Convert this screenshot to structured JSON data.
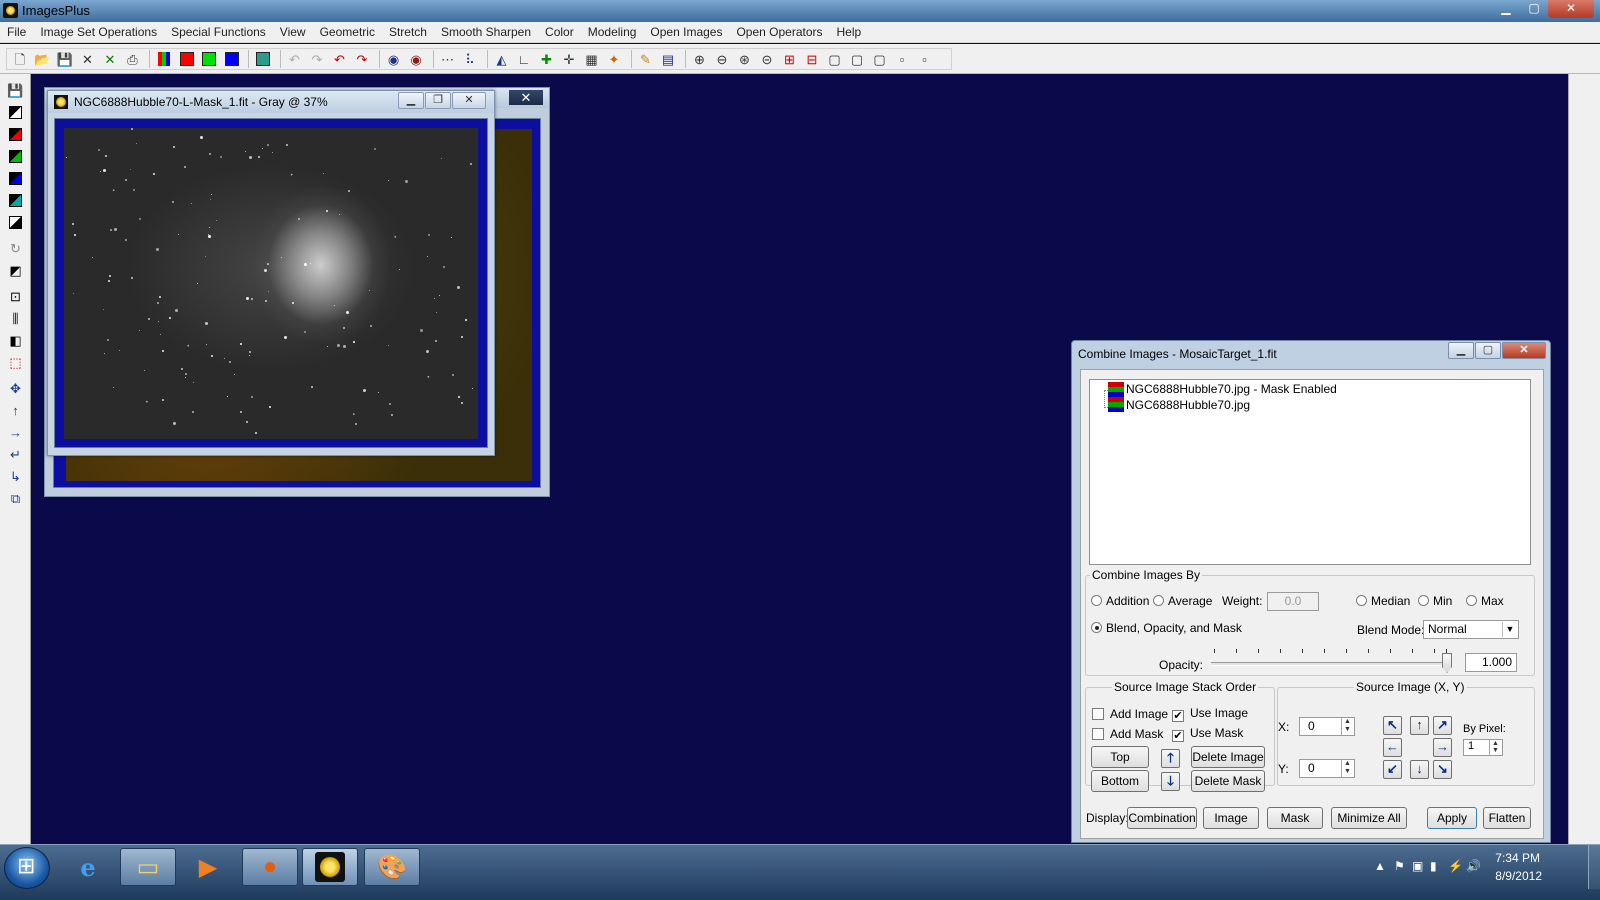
{
  "app": {
    "title": "ImagesPlus"
  },
  "menu": {
    "items": [
      "File",
      "Image Set Operations",
      "Special Functions",
      "View",
      "Geometric",
      "Stretch",
      "Smooth Sharpen",
      "Color",
      "Modeling",
      "Open Images",
      "Open Operators",
      "Help"
    ]
  },
  "toolbar": {
    "icons": [
      "new-icon",
      "open-icon",
      "save-icon",
      "close-image-icon",
      "close-all-icon",
      "print-icon",
      "rgb-channels-icon",
      "red-channel-icon",
      "green-channel-icon",
      "blue-channel-icon",
      "luminance-icon",
      "undo-disabled-icon",
      "redo-disabled-icon",
      "undo-icon",
      "redo-icon",
      "star-icon",
      "circle-icon",
      "dots-icon",
      "plot-icon",
      "histogram-icon",
      "curve-icon",
      "crosshair-plus-icon",
      "crosshair-icon",
      "calculator-icon",
      "palette-icon",
      "pencil-icon",
      "grid-icon",
      "zoom-in-icon",
      "zoom-out-icon",
      "zoom-fit-icon",
      "zoom-actual-icon",
      "zoom-plus-box-icon",
      "zoom-minus-box-icon",
      "view-box-1-icon",
      "view-box-2-icon",
      "view-box-3-icon",
      "view-box-4-icon",
      "view-box-5-icon"
    ],
    "colors": {
      "red": "#ff0000",
      "green": "#00e000",
      "blue": "#0000ff"
    }
  },
  "mdi": {
    "mask_window_title": "NGC6888Hubble70-L-Mask_1.fit - Gray @ 37%",
    "back_window_close": "✕"
  },
  "combine": {
    "title": "Combine Images - MosaicTarget_1.fit",
    "layers": [
      "NGC6888Hubble70.jpg - Mask Enabled",
      "NGC6888Hubble70.jpg"
    ],
    "combine_by_legend": "Combine Images By",
    "addition": "Addition",
    "average": "Average",
    "weight_label": "Weight:",
    "weight_value": "0.0",
    "median": "Median",
    "min": "Min",
    "max": "Max",
    "blend": "Blend, Opacity, and Mask",
    "blend_mode_label": "Blend Mode:",
    "blend_mode_value": "Normal",
    "opacity_label": "Opacity:",
    "opacity_value": "1.000",
    "stack_legend": "Source Image Stack Order",
    "add_image": "Add Image",
    "use_image": "Use Image",
    "add_mask": "Add Mask",
    "use_mask": "Use Mask",
    "top": "Top",
    "bottom": "Bottom",
    "delete_image": "Delete Image",
    "delete_mask": "Delete Mask",
    "source_legend": "Source Image (X, Y)",
    "x_label": "X:",
    "x_value": "0",
    "y_label": "Y:",
    "y_value": "0",
    "by_pixel_label": "By Pixel:",
    "by_pixel_value": "1",
    "display_label": "Display:",
    "combination": "Combination",
    "image": "Image",
    "mask": "Mask",
    "minimize_all": "Minimize All",
    "apply": "Apply",
    "flatten": "Flatten"
  },
  "taskbar": {
    "apps": [
      "internet-explorer-icon",
      "file-explorer-icon",
      "media-player-icon",
      "firefox-icon",
      "imagesplus-icon",
      "paint-icon"
    ],
    "time": "7:34 PM",
    "date": "8/9/2012"
  }
}
